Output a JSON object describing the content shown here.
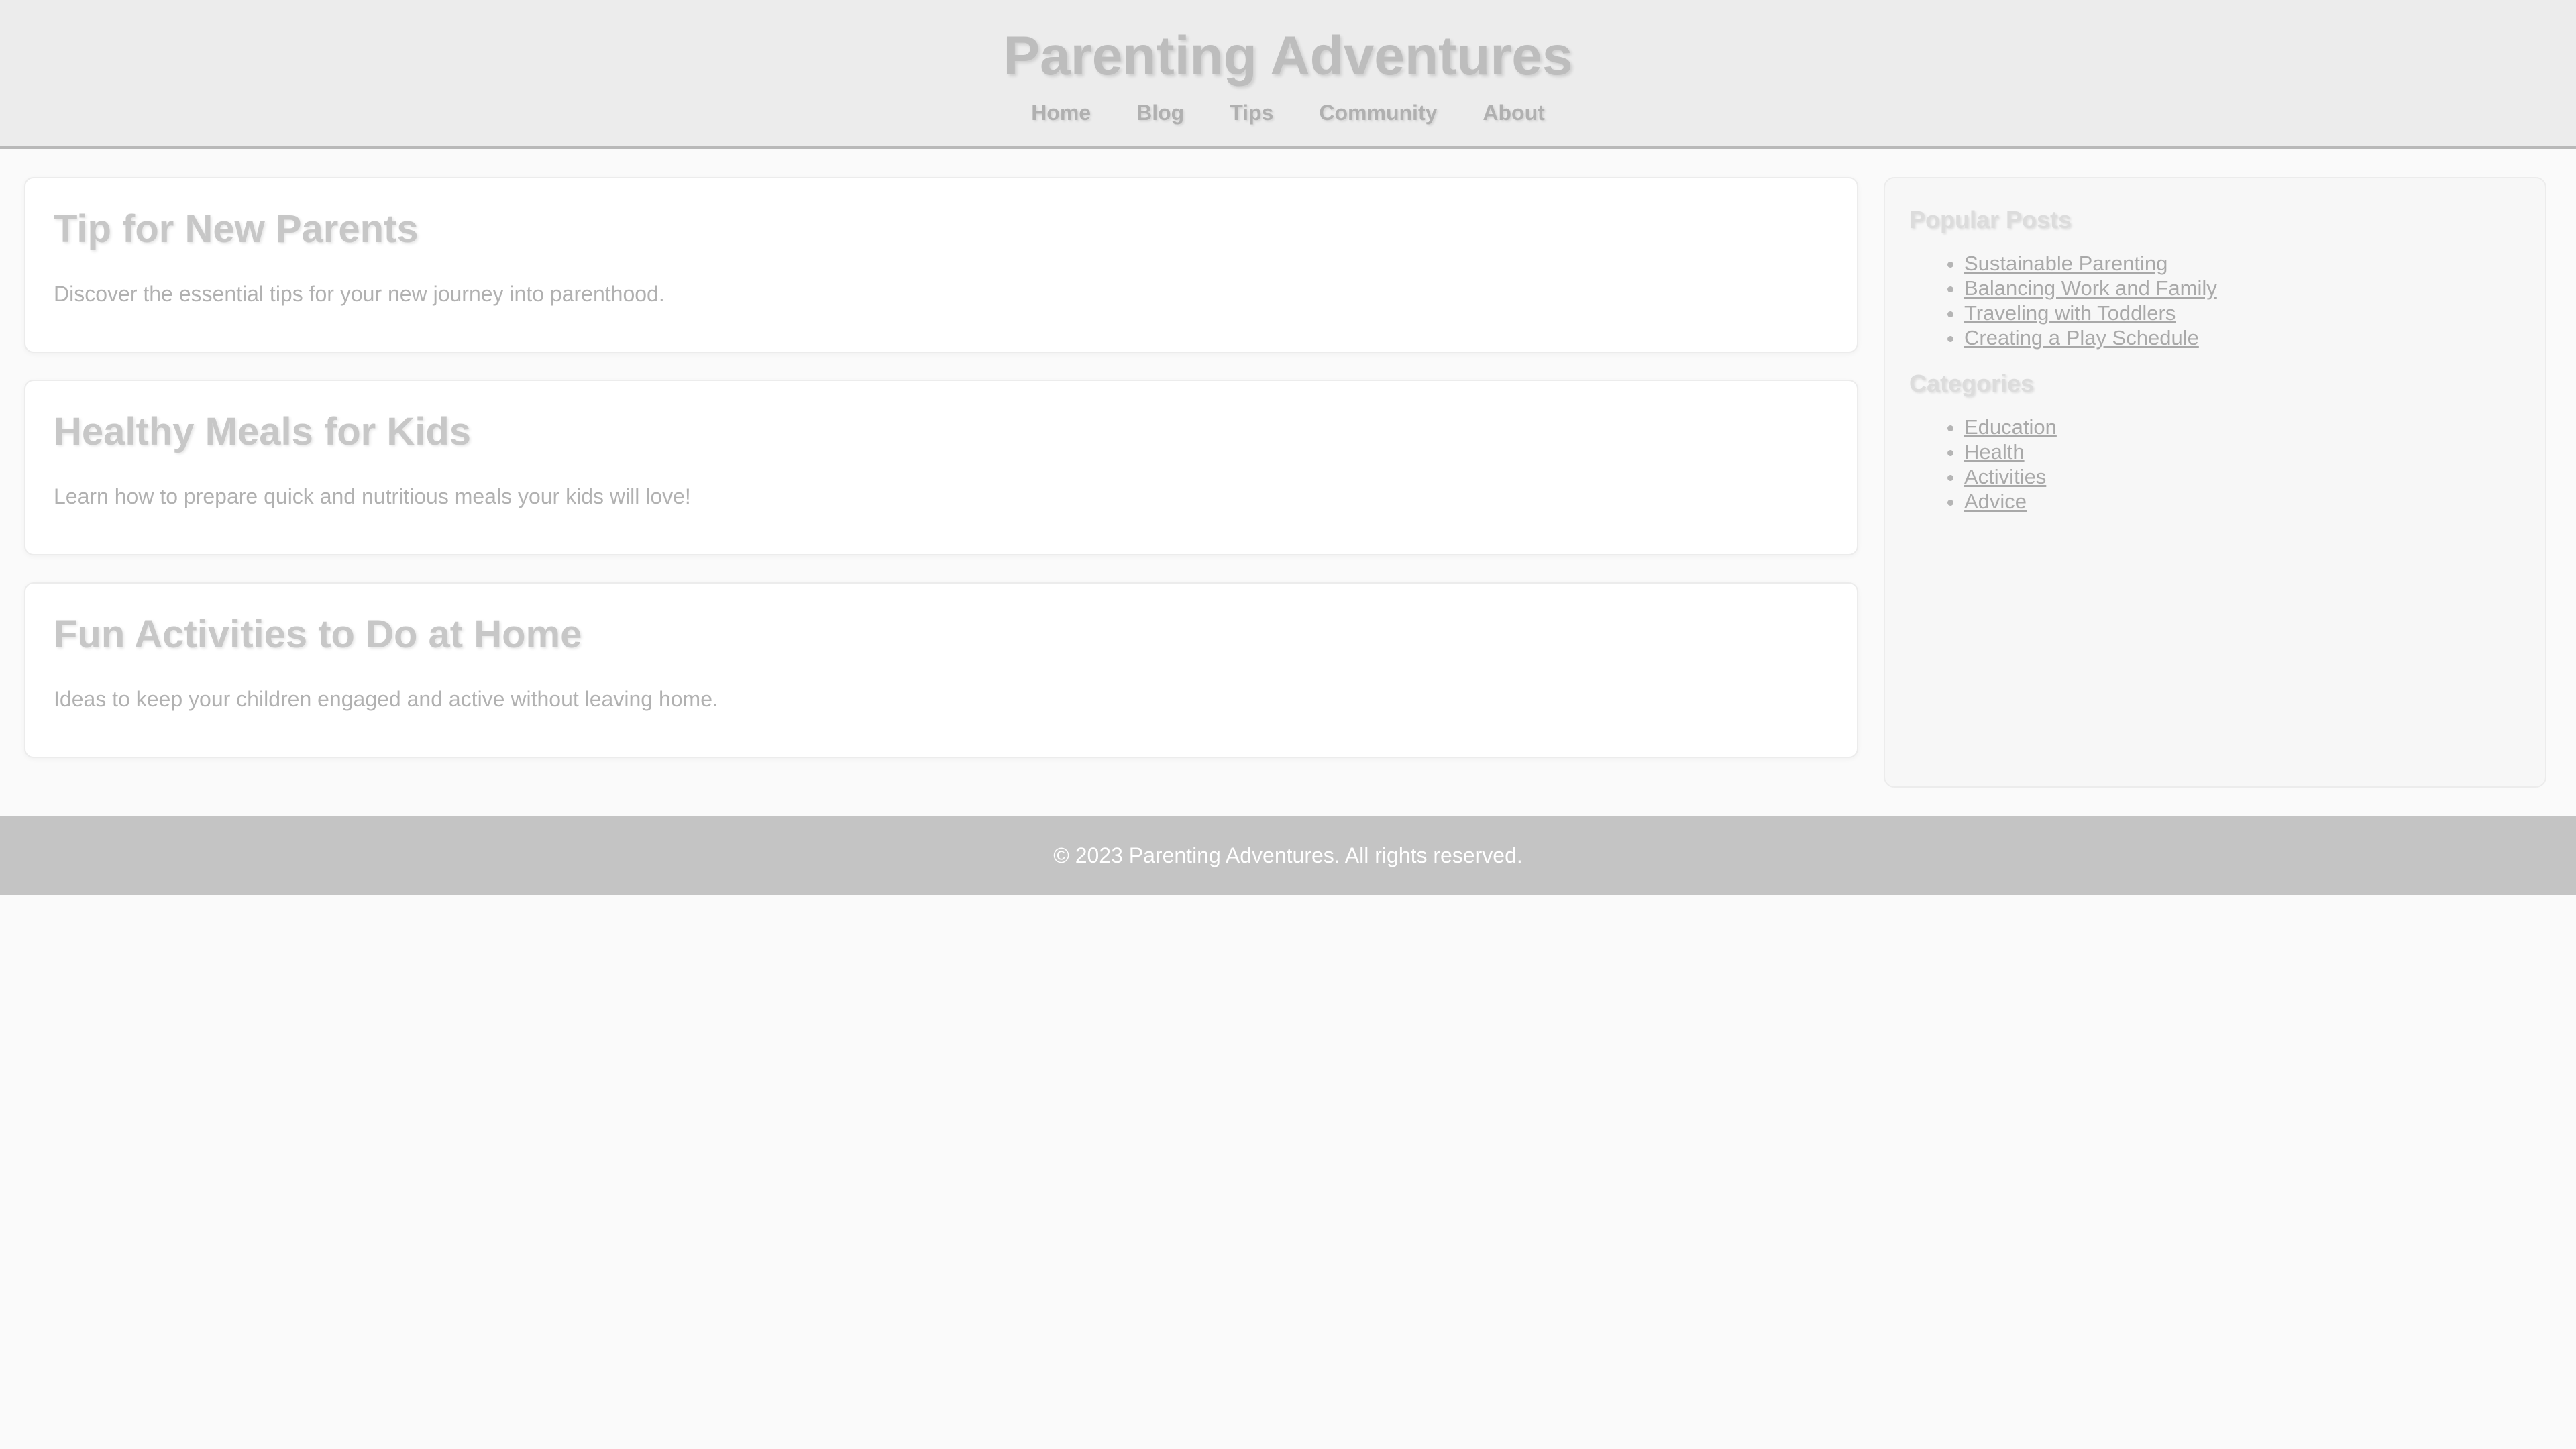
{
  "header": {
    "title": "Parenting Adventures",
    "nav": [
      "Home",
      "Blog",
      "Tips",
      "Community",
      "About"
    ]
  },
  "articles": [
    {
      "title": "Tip for New Parents",
      "summary": "Discover the essential tips for your new journey into parenthood."
    },
    {
      "title": "Healthy Meals for Kids",
      "summary": "Learn how to prepare quick and nutritious meals your kids will love!"
    },
    {
      "title": "Fun Activities to Do at Home",
      "summary": "Ideas to keep your children engaged and active without leaving home."
    }
  ],
  "sidebar": {
    "popular_heading": "Popular Posts",
    "popular": [
      "Sustainable Parenting",
      "Balancing Work and Family",
      "Traveling with Toddlers",
      "Creating a Play Schedule"
    ],
    "categories_heading": "Categories",
    "categories": [
      "Education",
      "Health",
      "Activities",
      "Advice"
    ]
  },
  "footer": {
    "text": "© 2023 Parenting Adventures. All rights reserved."
  }
}
